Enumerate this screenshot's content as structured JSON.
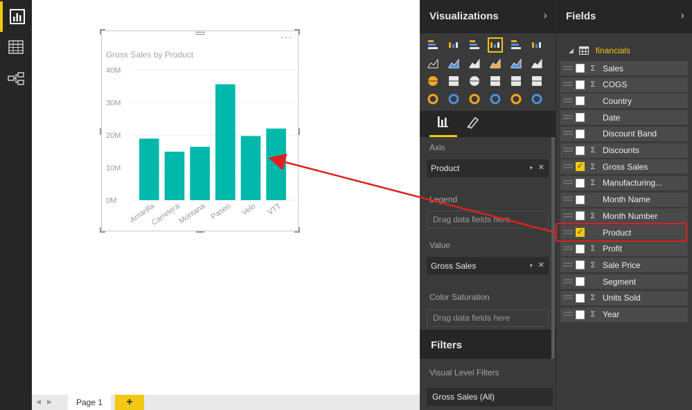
{
  "left_nav": {
    "items": [
      {
        "name": "report-view",
        "icon": "bar-chart-icon"
      },
      {
        "name": "data-view",
        "icon": "table-grid-icon"
      },
      {
        "name": "relationships-view",
        "icon": "relationships-icon"
      }
    ]
  },
  "visual": {
    "menu_glyph": "···"
  },
  "chart_data": {
    "type": "bar",
    "title": "Gross Sales by Product",
    "categories": [
      "Amarilla",
      "Carretera",
      "Montana",
      "Paseo",
      "Velo",
      "VTT"
    ],
    "series": [
      {
        "values": [
          18.9,
          14.9,
          16.4,
          35.6,
          19.7,
          22.0
        ]
      }
    ],
    "ylim": [
      0,
      40
    ],
    "y_ticks": [
      "0M",
      "10M",
      "20M",
      "30M",
      "40M"
    ],
    "y_tick_values": [
      0,
      10,
      20,
      30,
      40
    ],
    "bar_color": "#01b8aa",
    "grid": true,
    "xlabel": "",
    "ylabel": ""
  },
  "page_bar": {
    "prev_arrow": "◀",
    "next_arrow": "▶",
    "page_tab": "Page 1",
    "add_page": "+"
  },
  "visualizations": {
    "title": "Visualizations",
    "chevron": "›",
    "selected_icon": "clustered-column-chart-icon",
    "wells": {
      "axis_label": "Axis",
      "axis_value": "Product",
      "legend_label": "Legend",
      "legend_placeholder": "Drag data fields here",
      "value_label": "Value",
      "value_value": "Gross Sales",
      "color_saturation_label": "Color Saturation",
      "color_saturation_placeholder": "Drag data fields here"
    },
    "remove_glyph": "✕",
    "dropdown_glyph": "▾"
  },
  "filters": {
    "title": "Filters",
    "visual_level_label": "Visual Level Filters",
    "filter_item": "Gross Sales (All)"
  },
  "fields": {
    "title": "Fields",
    "chevron": "›",
    "table_name": "financials",
    "expand_glyph": "◢",
    "items": [
      {
        "label": "Sales",
        "sigma": true,
        "checked": false
      },
      {
        "label": "COGS",
        "sigma": true,
        "checked": false
      },
      {
        "label": "Country",
        "sigma": false,
        "checked": false
      },
      {
        "label": "Date",
        "sigma": false,
        "checked": false
      },
      {
        "label": "Discount Band",
        "sigma": false,
        "checked": false
      },
      {
        "label": "Discounts",
        "sigma": true,
        "checked": false
      },
      {
        "label": "Gross Sales",
        "sigma": true,
        "checked": true
      },
      {
        "label": "Manufacturing...",
        "sigma": true,
        "checked": false
      },
      {
        "label": "Month Name",
        "sigma": false,
        "checked": false
      },
      {
        "label": "Month Number",
        "sigma": true,
        "checked": false
      },
      {
        "label": "Product",
        "sigma": false,
        "checked": true
      },
      {
        "label": "Profit",
        "sigma": true,
        "checked": false
      },
      {
        "label": "Sale Price",
        "sigma": true,
        "checked": false
      },
      {
        "label": "Segment",
        "sigma": false,
        "checked": false
      },
      {
        "label": "Units Sold",
        "sigma": true,
        "checked": false
      },
      {
        "label": "Year",
        "sigma": true,
        "checked": false
      }
    ],
    "sigma_glyph": "Σ",
    "check_glyph": "✓"
  },
  "colors": {
    "accent": "#f2c811",
    "annotation_red": "#e02020",
    "pane_bg": "#3a3a3a",
    "header_bg": "#262626"
  }
}
